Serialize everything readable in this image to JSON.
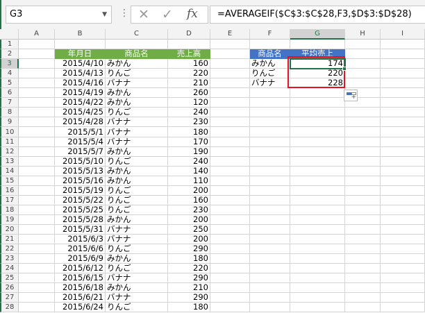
{
  "name_box": "G3",
  "formula": "=AVERAGEIF($C$3:$C$28,F3,$D$3:$D$28)",
  "formula_buttons": {
    "cancel": "✕",
    "enter": "✓",
    "fx": "fx"
  },
  "columns": [
    "A",
    "B",
    "C",
    "D",
    "E",
    "F",
    "G",
    "H",
    "I"
  ],
  "selected_column": "G",
  "selected_row": 3,
  "table_headers": [
    "年月日",
    "商品名",
    "売上高"
  ],
  "rows": [
    [
      "2015/4/10",
      "みかん",
      "160"
    ],
    [
      "2015/4/13",
      "りんご",
      "220"
    ],
    [
      "2015/4/16",
      "バナナ",
      "210"
    ],
    [
      "2015/4/19",
      "みかん",
      "260"
    ],
    [
      "2015/4/22",
      "みかん",
      "120"
    ],
    [
      "2015/4/25",
      "りんご",
      "240"
    ],
    [
      "2015/4/28",
      "バナナ",
      "230"
    ],
    [
      "2015/5/1",
      "バナナ",
      "180"
    ],
    [
      "2015/5/4",
      "バナナ",
      "170"
    ],
    [
      "2015/5/7",
      "みかん",
      "190"
    ],
    [
      "2015/5/10",
      "りんご",
      "240"
    ],
    [
      "2015/5/13",
      "みかん",
      "140"
    ],
    [
      "2015/5/16",
      "みかん",
      "110"
    ],
    [
      "2015/5/19",
      "りんご",
      "200"
    ],
    [
      "2015/5/22",
      "りんご",
      "160"
    ],
    [
      "2015/5/25",
      "りんご",
      "230"
    ],
    [
      "2015/5/28",
      "みかん",
      "200"
    ],
    [
      "2015/5/31",
      "バナナ",
      "250"
    ],
    [
      "2015/6/3",
      "バナナ",
      "200"
    ],
    [
      "2015/6/6",
      "りんご",
      "290"
    ],
    [
      "2015/6/9",
      "みかん",
      "180"
    ],
    [
      "2015/6/12",
      "りんご",
      "220"
    ],
    [
      "2015/6/15",
      "バナナ",
      "290"
    ],
    [
      "2015/6/18",
      "みかん",
      "210"
    ],
    [
      "2015/6/21",
      "バナナ",
      "290"
    ],
    [
      "2015/6/24",
      "りんご",
      "180"
    ]
  ],
  "summary_headers": [
    "商品名",
    "平均売上"
  ],
  "summary": [
    [
      "みかん",
      "174"
    ],
    [
      "りんご",
      "220"
    ],
    [
      "バナナ",
      "228"
    ]
  ],
  "colors": {
    "green_header": "#70ad47",
    "blue_header": "#4472c4",
    "selection": "#217346",
    "highlight": "#e81123"
  }
}
